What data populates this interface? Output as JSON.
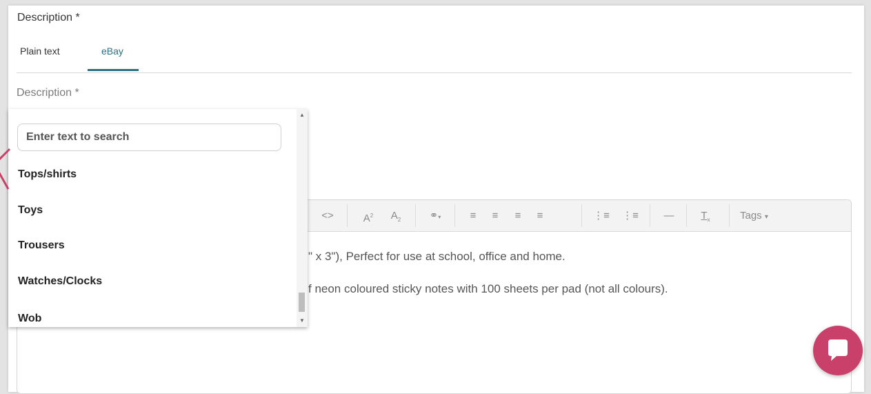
{
  "section": {
    "title": "Description *"
  },
  "tabs": [
    {
      "label": "Plain text"
    },
    {
      "label": "eBay"
    }
  ],
  "field": {
    "label": "Description *"
  },
  "dropdown": {
    "search_placeholder": "Enter text to search",
    "options": [
      "Tops/shirts",
      "Toys",
      "Trousers",
      "Watches/Clocks",
      "Wob"
    ]
  },
  "toolbar": {
    "items": [
      "code-icon",
      "superscript-icon",
      "subscript-icon",
      "link-icon",
      "align-left-icon",
      "align-center-icon",
      "align-right-icon",
      "align-justify-icon",
      "bullet-list-icon",
      "numbered-list-icon",
      "horizontal-rule-icon",
      "clear-format-icon"
    ],
    "tags_label": "Tags"
  },
  "editor": {
    "line1": "\" x 3\"), Perfect for use at school, office and home.",
    "line2": "f neon coloured sticky notes with 100 sheets per pad (not all colours)."
  },
  "colors": {
    "accent": "#2c6e7f",
    "chat": "#c9406a"
  }
}
